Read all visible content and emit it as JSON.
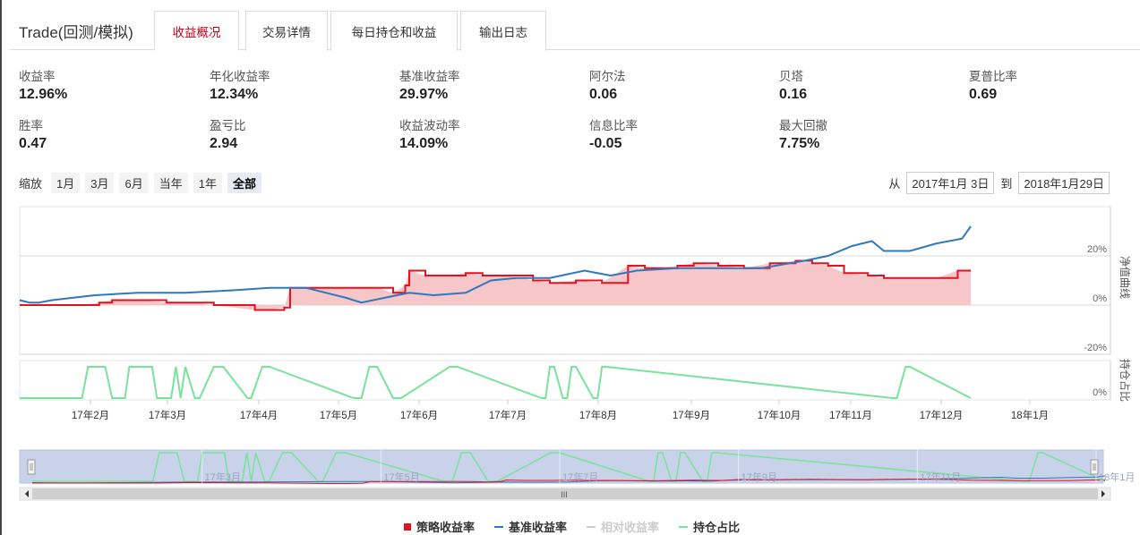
{
  "app": {
    "title": "Trade(回测/模拟)"
  },
  "tabs": [
    {
      "label": "收益概况",
      "active": true
    },
    {
      "label": "交易详情",
      "active": false
    },
    {
      "label": "每日持仓和收益",
      "active": false
    },
    {
      "label": "输出日志",
      "active": false
    }
  ],
  "metrics": [
    {
      "label": "收益率",
      "value": "12.96%"
    },
    {
      "label": "年化收益率",
      "value": "12.34%"
    },
    {
      "label": "基准收益率",
      "value": "29.97%"
    },
    {
      "label": "阿尔法",
      "value": "0.06"
    },
    {
      "label": "贝塔",
      "value": "0.16"
    },
    {
      "label": "夏普比率",
      "value": "0.69"
    },
    {
      "label": "胜率",
      "value": "0.47"
    },
    {
      "label": "盈亏比",
      "value": "2.94"
    },
    {
      "label": "收益波动率",
      "value": "14.09%"
    },
    {
      "label": "信息比率",
      "value": "-0.05"
    },
    {
      "label": "最大回撤",
      "value": "7.75%"
    }
  ],
  "zoom": {
    "label": "缩放",
    "buttons": [
      {
        "label": "1月",
        "active": false
      },
      {
        "label": "3月",
        "active": false
      },
      {
        "label": "6月",
        "active": false
      },
      {
        "label": "当年",
        "active": false
      },
      {
        "label": "1年",
        "active": false
      },
      {
        "label": "全部",
        "active": true
      }
    ]
  },
  "range": {
    "from_label": "从",
    "from": "2017年1月 3日",
    "to_label": "到",
    "to": "2018年1月29日"
  },
  "colors": {
    "strategy": "#e8101e",
    "strategy_fill": "#f7c6c8",
    "benchmark": "#2f78bd",
    "position": "#7ae39a",
    "relative": "#cccccc",
    "navigator_bg": "#c8d3ea"
  },
  "chart_data": {
    "type": "line",
    "x_axis": {
      "ticks": [
        "17年2月",
        "17年3月",
        "17年4月",
        "17年5月",
        "17年6月",
        "17年7月",
        "17年8月",
        "17年9月",
        "17年10月",
        "17年11月",
        "17年12月",
        "18年1月"
      ],
      "range": [
        "2017-01-03",
        "2018-01-29"
      ]
    },
    "panels": [
      {
        "name": "净值曲线",
        "yticks": [
          "20%",
          "0%",
          "-20%"
        ],
        "ylim": [
          -20,
          20
        ]
      },
      {
        "name": "持仓占比",
        "yticks": [
          "0%"
        ],
        "ylim": [
          0,
          100
        ]
      }
    ],
    "series": [
      {
        "name": "策略收益率",
        "x_month": [
          0.0,
          0.5,
          1.0,
          1.4,
          1.55,
          1.7,
          2.0,
          2.3,
          2.6,
          2.8,
          3.3,
          3.5,
          3.7,
          3.78,
          4.0,
          4.5,
          4.9,
          5.1,
          5.25,
          5.3,
          5.5,
          5.8,
          6.0,
          6.2,
          6.5,
          6.8,
          7.0,
          7.3,
          7.6,
          7.9,
          8.1,
          8.3,
          8.5,
          8.7,
          9.0,
          9.3,
          9.6,
          9.9,
          10.1,
          10.3,
          10.5,
          10.8,
          11.0,
          11.3,
          11.6,
          11.85,
          12.0
        ],
        "values": [
          0,
          0,
          0,
          0,
          1,
          2,
          2,
          1,
          1,
          0,
          -2,
          -2,
          -1,
          7,
          7,
          7,
          7,
          5,
          8,
          14,
          12,
          12,
          13,
          12,
          12,
          10,
          9,
          10,
          9,
          16,
          15,
          15,
          16,
          17,
          16,
          15,
          17,
          18,
          17,
          16,
          13,
          12,
          11,
          11,
          11,
          14,
          14
        ]
      },
      {
        "name": "基准收益率",
        "x_month": [
          0.0,
          0.3,
          0.6,
          1.0,
          1.5,
          2.0,
          2.5,
          3.0,
          3.5,
          4.0,
          4.5,
          4.7,
          5.0,
          5.3,
          5.6,
          6.0,
          6.3,
          6.6,
          7.0,
          7.4,
          7.7,
          8.0,
          8.5,
          9.0,
          9.5,
          10.0,
          10.3,
          10.6,
          10.85,
          11.0,
          11.3,
          11.6,
          11.9,
          12.0
        ],
        "values": [
          2,
          1,
          1,
          2,
          4,
          5,
          5,
          6,
          7,
          7,
          3,
          1,
          3,
          5,
          4,
          5,
          10,
          11,
          11,
          14,
          12,
          14,
          15,
          15,
          15,
          18,
          20,
          24,
          26,
          22,
          22,
          25,
          27,
          32,
          31
        ]
      },
      {
        "name": "相对收益率",
        "values": []
      },
      {
        "name": "持仓占比",
        "x_month": [
          0.0,
          1.35,
          1.42,
          1.62,
          1.7,
          1.85,
          1.9,
          2.15,
          2.2,
          2.35,
          2.4,
          2.45,
          2.5,
          2.6,
          2.65,
          2.8,
          2.9,
          3.2,
          3.25,
          3.4,
          3.5,
          4.6,
          4.7,
          4.8,
          4.9,
          5.1,
          5.2,
          5.8,
          5.9,
          6.9,
          6.95,
          7.0,
          7.05,
          7.15,
          7.2,
          7.25,
          7.3,
          7.5,
          7.55,
          7.6,
          7.65,
          11.1,
          11.15,
          11.25,
          11.3,
          12.0
        ],
        "values": [
          0,
          0,
          100,
          100,
          0,
          0,
          100,
          100,
          0,
          0,
          100,
          0,
          100,
          0,
          0,
          100,
          100,
          0,
          0,
          100,
          100,
          0,
          0,
          100,
          100,
          0,
          0,
          100,
          100,
          0,
          0,
          100,
          100,
          0,
          0,
          100,
          100,
          0,
          0,
          100,
          100,
          0,
          0,
          100,
          100,
          0
        ]
      }
    ],
    "legend_position": "bottom-center"
  },
  "navigator": {
    "scroll_handle": "III"
  }
}
